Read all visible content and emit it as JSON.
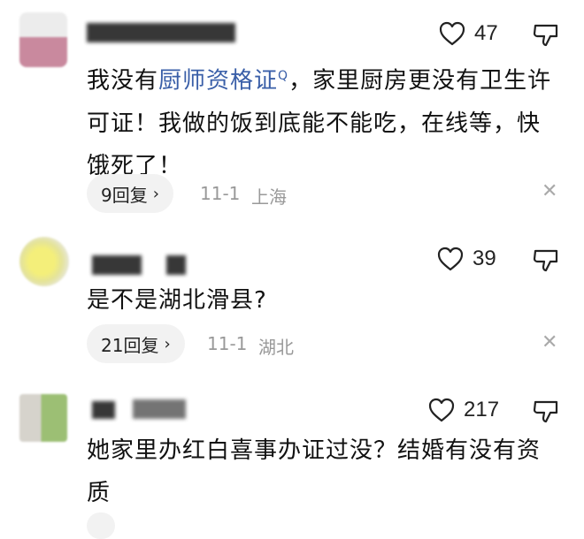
{
  "comments": [
    {
      "likes": "47",
      "text_before": "我没有",
      "link": "厨师资格证",
      "text_after": "，家里厨房更没有卫生许可证！我做的饭到底能不能吃，在线等，快饿死了！",
      "replies": "9回复",
      "date": "11-1",
      "location": "上海"
    },
    {
      "likes": "39",
      "text": "是不是湖北滑县?",
      "replies": "21回复",
      "date": "11-1",
      "location": "湖北"
    },
    {
      "likes": "217",
      "text": "她家里办红白喜事办证过没？结婚有没有资质"
    }
  ],
  "icons": {
    "like": "heart-outline-icon",
    "dislike": "thumbs-down-outline-icon",
    "close": "close-icon",
    "search": "search-icon"
  }
}
